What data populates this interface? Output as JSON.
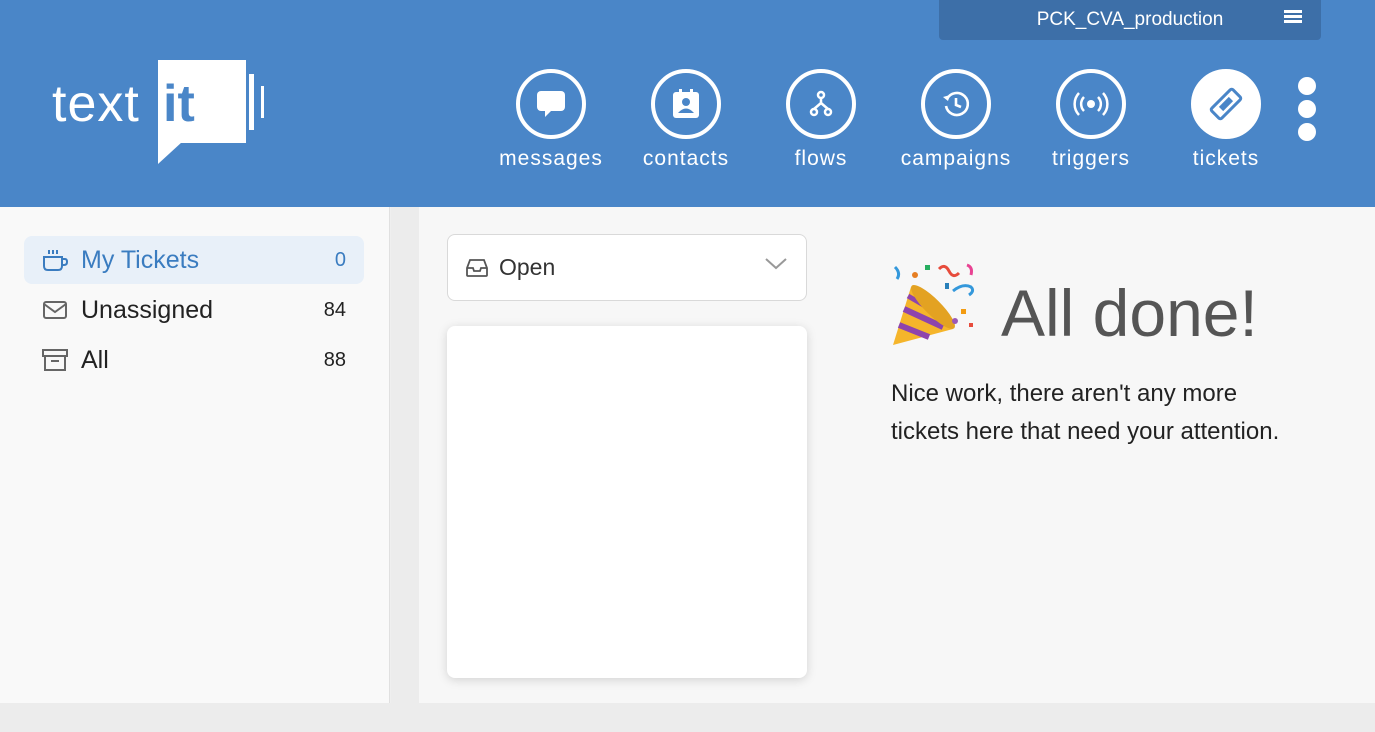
{
  "org": {
    "name": "PCK_CVA_production",
    "menu_icon": "hamburger-icon"
  },
  "logo": {
    "text": "text",
    "accent": "it"
  },
  "nav": [
    {
      "label": "messages",
      "icon": "chat-bubble-icon"
    },
    {
      "label": "contacts",
      "icon": "contact-card-icon"
    },
    {
      "label": "flows",
      "icon": "flow-branch-icon"
    },
    {
      "label": "campaigns",
      "icon": "clock-refresh-icon"
    },
    {
      "label": "triggers",
      "icon": "broadcast-icon"
    },
    {
      "label": "tickets",
      "icon": "ticket-icon",
      "active": true
    }
  ],
  "sidebar": {
    "items": [
      {
        "label": "My Tickets",
        "count": "0",
        "icon": "mug-icon",
        "active": true
      },
      {
        "label": "Unassigned",
        "count": "84",
        "icon": "envelope-icon"
      },
      {
        "label": "All",
        "count": "88",
        "icon": "archive-box-icon"
      }
    ]
  },
  "status_filter": {
    "value": "Open",
    "icon": "inbox-icon"
  },
  "empty_state": {
    "title": "All done!",
    "message": "Nice work, there aren't any more tickets here that need your attention."
  },
  "colors": {
    "brand": "#4a86c8",
    "active_text": "#3a7cc0",
    "active_bg": "#e8f0f9"
  }
}
